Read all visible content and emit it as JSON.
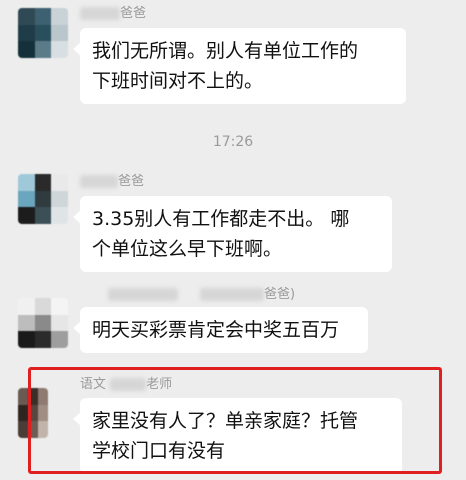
{
  "chat": {
    "timestamp": "17:26",
    "messages": [
      {
        "sender_suffix": "爸爸",
        "lines": [
          "我们无所谓。别人有单位工作的",
          "下班时间对不上的。"
        ]
      },
      {
        "sender_suffix": "爸爸",
        "lines": [
          "3.35别人有工作都走不出。 哪",
          "个单位这么早下班啊。"
        ]
      },
      {
        "sender_suffix": "爸爸)",
        "lines": [
          "明天买彩票肯定会中奖五百万"
        ]
      },
      {
        "sender_prefix": "语文",
        "sender_suffix": "老师",
        "lines": [
          "家里没有人了？单亲家庭？托管",
          "学校门口有没有"
        ]
      }
    ]
  },
  "colors": {
    "background": "#ededed",
    "bubble": "#ffffff",
    "highlight_border": "#e02020",
    "meta_text": "#9a9a9a"
  }
}
